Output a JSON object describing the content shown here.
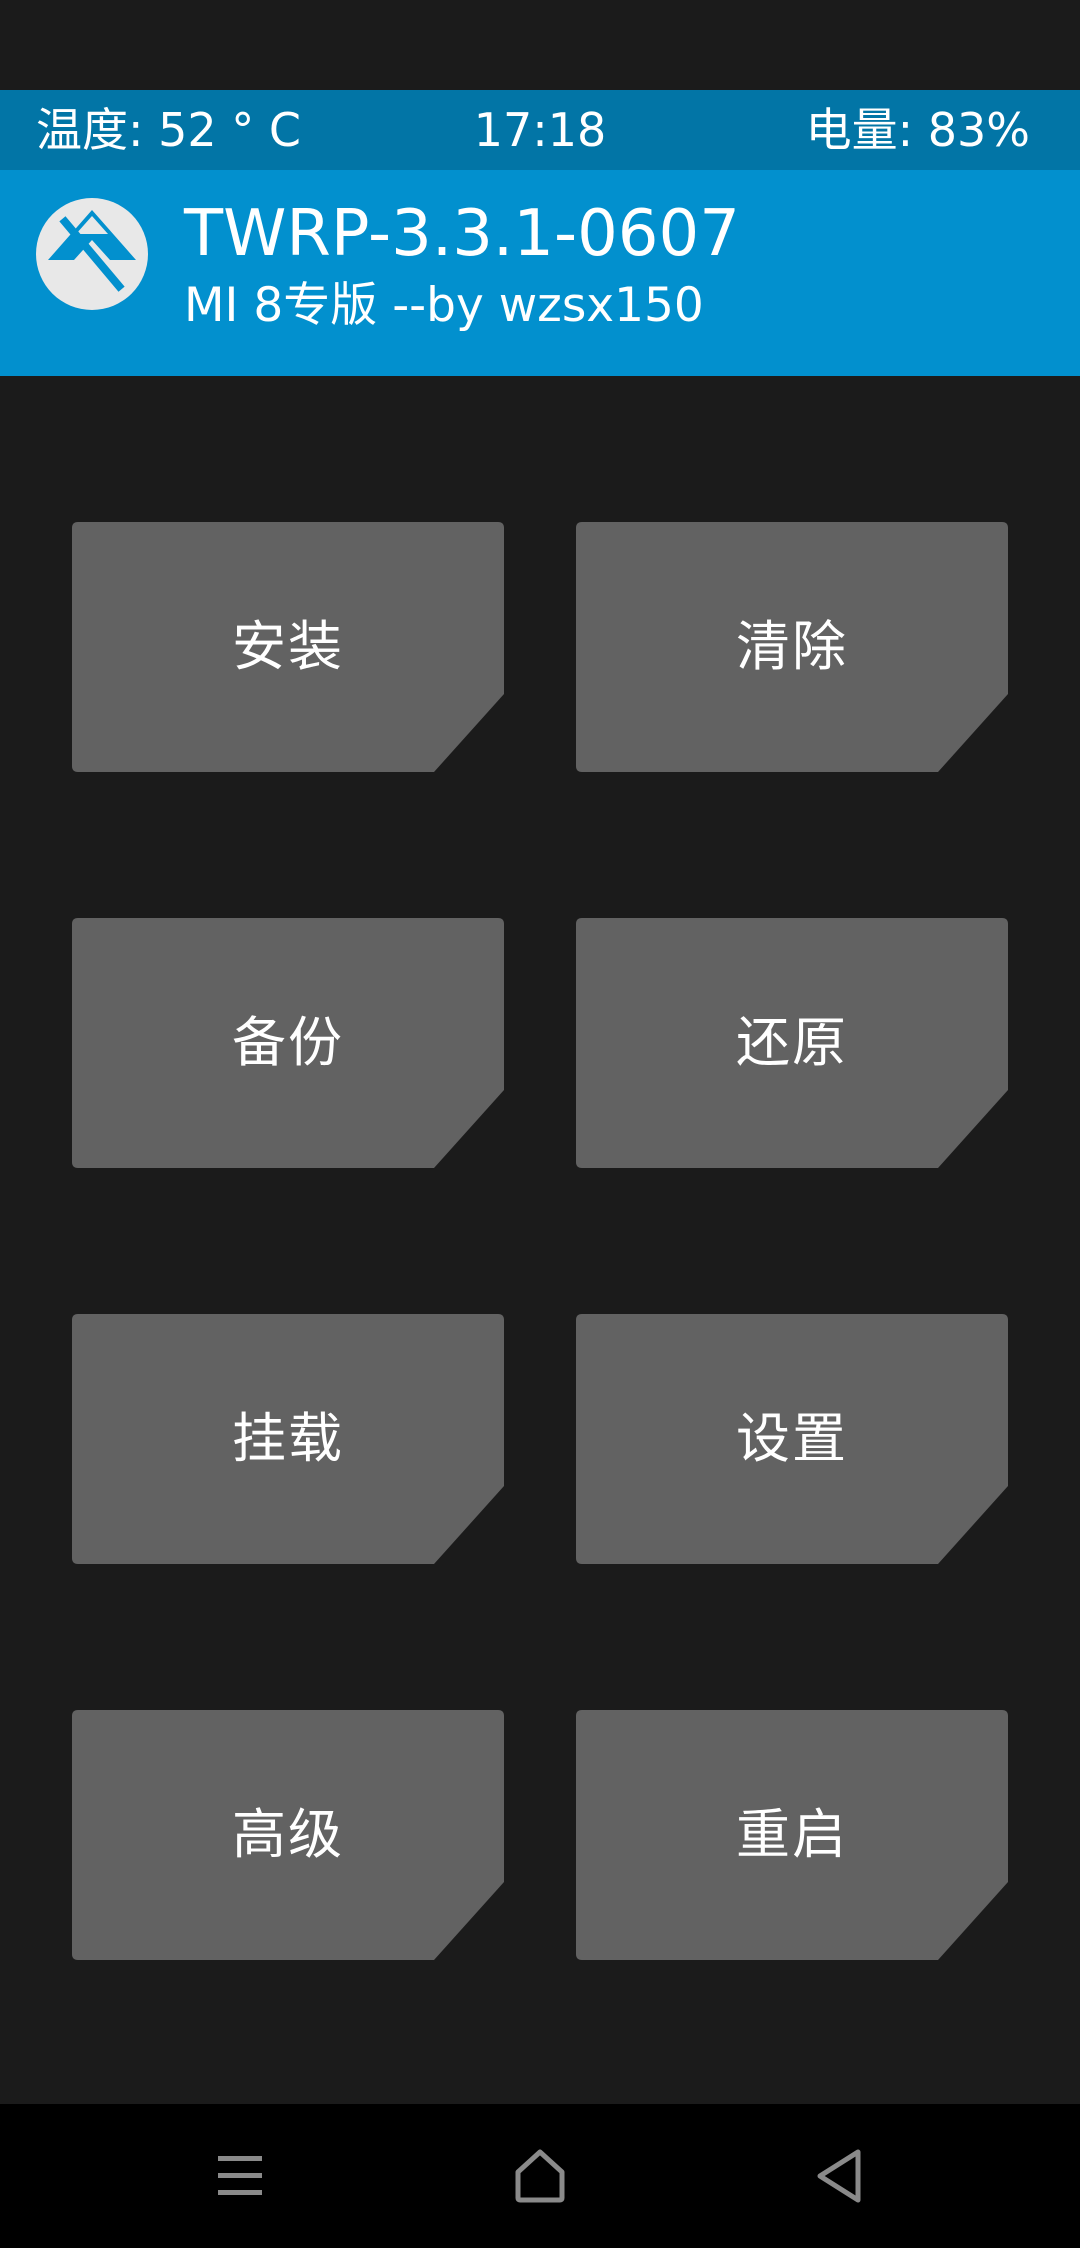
{
  "status_bar": {
    "temperature": "温度: 52 ° C",
    "time": "17:18",
    "battery": "电量: 83%"
  },
  "header": {
    "logo_icon": "twrp-logo-icon",
    "title": "TWRP-3.3.1-0607",
    "subtitle": "MI 8专版  --by wzsx150"
  },
  "menu": {
    "buttons": [
      {
        "label": "安装"
      },
      {
        "label": "清除"
      },
      {
        "label": "备份"
      },
      {
        "label": "还原"
      },
      {
        "label": "挂载"
      },
      {
        "label": "设置"
      },
      {
        "label": "高级"
      },
      {
        "label": "重启"
      }
    ]
  },
  "nav_bar": {
    "menu_icon": "menu-icon",
    "home_icon": "home-icon",
    "back_icon": "back-icon"
  },
  "colors": {
    "status_bar_bg": "#0275a6",
    "header_bg": "#0290ce",
    "background": "#1b1b1b",
    "button_bg": "#626262",
    "nav_bg": "#000000"
  }
}
